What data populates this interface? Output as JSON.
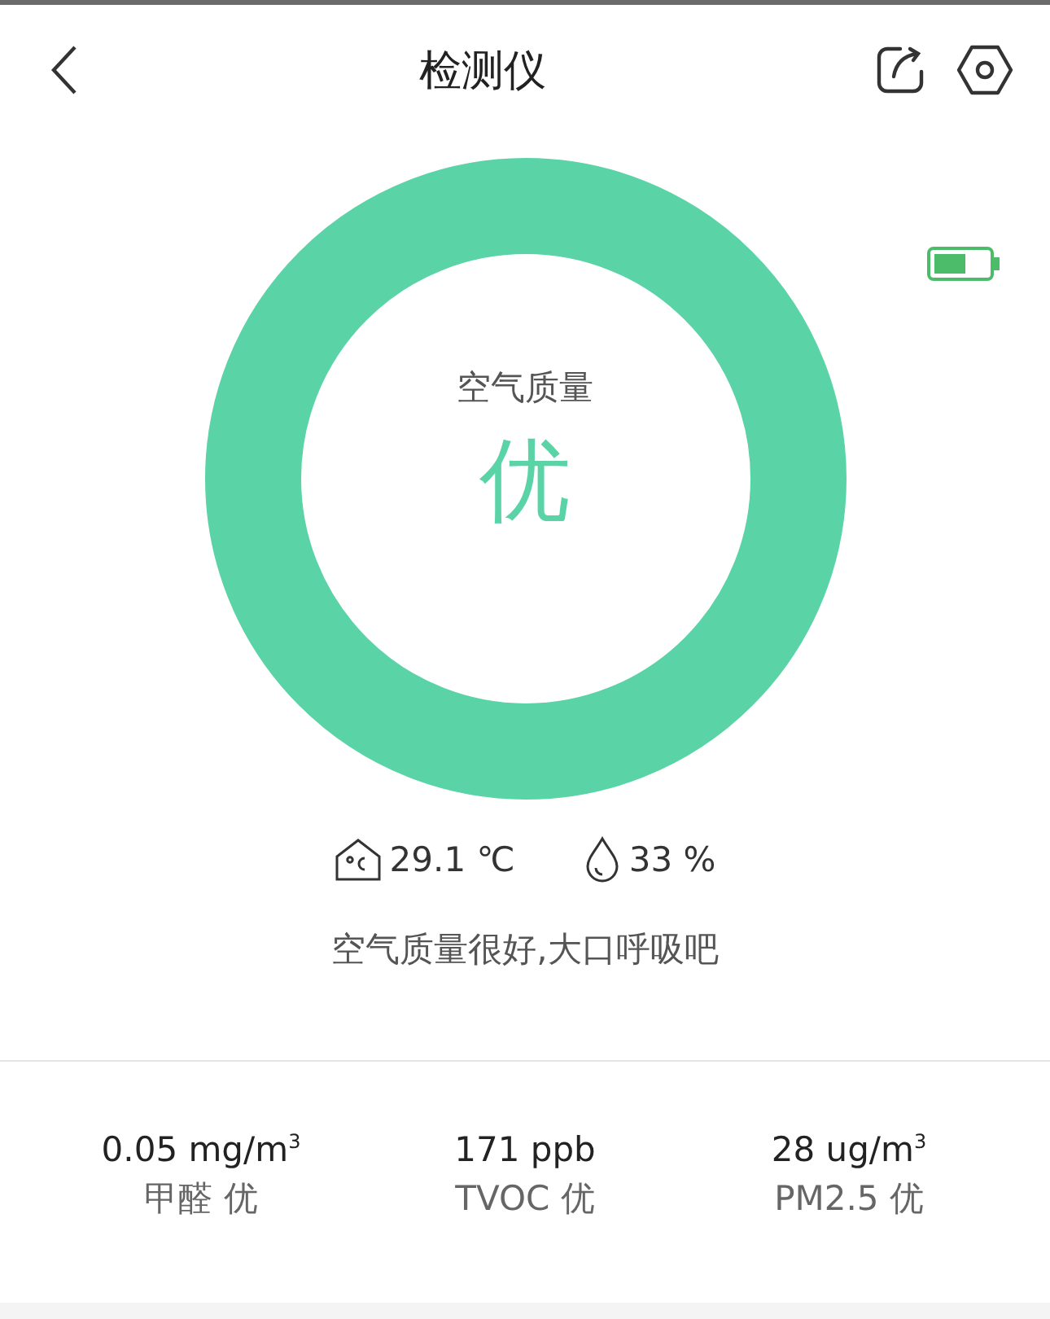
{
  "header": {
    "title": "检测仪"
  },
  "gauge": {
    "label": "空气质量",
    "grade": "优",
    "color": "#5ad3a6"
  },
  "readings": [
    {
      "kind": "temperature",
      "value": "29.1 ℃"
    },
    {
      "kind": "humidity",
      "value": "33 %"
    }
  ],
  "message": "空气质量很好,大口呼吸吧",
  "metrics": [
    {
      "value": "0.05 mg/m$^{3}$",
      "label": "甲醛 优"
    },
    {
      "value": "171 ppb",
      "label": "TVOC 优"
    },
    {
      "value": "28 ug/m$^{3}$",
      "label": "PM2.5 优"
    }
  ]
}
